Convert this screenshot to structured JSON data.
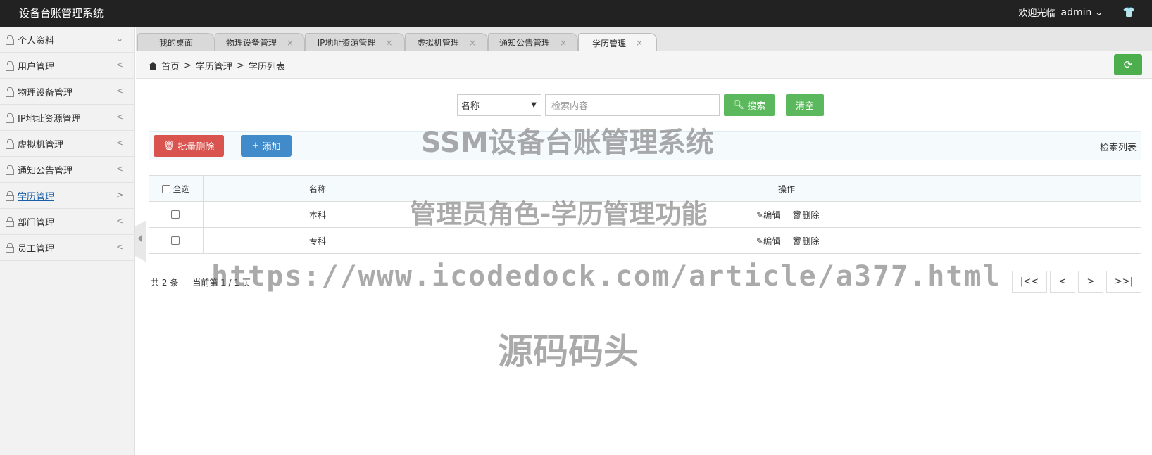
{
  "app": {
    "title": "设备台账管理系统"
  },
  "header": {
    "welcome": "欢迎光临",
    "user": "admin",
    "user_caret": "⌄"
  },
  "sidebar": {
    "items": [
      {
        "label": "个人资料",
        "chevron": "⌄"
      },
      {
        "label": "用户管理",
        "chevron": "<"
      },
      {
        "label": "物理设备管理",
        "chevron": "<"
      },
      {
        "label": "IP地址资源管理",
        "chevron": "<"
      },
      {
        "label": "虚拟机管理",
        "chevron": "<"
      },
      {
        "label": "通知公告管理",
        "chevron": "<"
      },
      {
        "label": "学历管理",
        "chevron": ">"
      },
      {
        "label": "部门管理",
        "chevron": "<"
      },
      {
        "label": "员工管理",
        "chevron": "<"
      }
    ]
  },
  "tabs": [
    {
      "label": "我的桌面",
      "close": ""
    },
    {
      "label": "物理设备管理",
      "close": "×"
    },
    {
      "label": "IP地址资源管理",
      "close": "×"
    },
    {
      "label": "虚拟机管理",
      "close": "×"
    },
    {
      "label": "通知公告管理",
      "close": "×"
    },
    {
      "label": "学历管理",
      "close": "×"
    }
  ],
  "breadcrumb": {
    "home": "首页",
    "sep": ">",
    "level1": "学历管理",
    "level2": "学历列表"
  },
  "search": {
    "field_value": "名称",
    "placeholder": "检索内容",
    "search_label": "搜索",
    "clear_label": "清空"
  },
  "toolbar": {
    "batch_delete_label": "批量删除",
    "add_label": "添加",
    "search_list_label": "检索列表"
  },
  "table": {
    "headers": {
      "select_all": "全选",
      "name": "名称",
      "ops": "操作"
    },
    "rows": [
      {
        "name": "本科",
        "edit": "编辑",
        "delete": "删除"
      },
      {
        "name": "专科",
        "edit": "编辑",
        "delete": "删除"
      }
    ]
  },
  "footer": {
    "total": "共 2 条",
    "page_info": "当前第 1 / 1 页"
  },
  "pager": {
    "first": "|<<",
    "prev": "<",
    "next": ">",
    "last": ">>|"
  },
  "watermarks": {
    "line1": "SSM设备台账管理系统",
    "line2": "管理员角色-学历管理功能",
    "line3": "https://www.icodedock.com/article/a377.html",
    "line4": "源码码头"
  },
  "colors": {
    "topbar": "#222222",
    "green": "#5cb85c",
    "red": "#d9534f",
    "blue": "#428bca"
  }
}
